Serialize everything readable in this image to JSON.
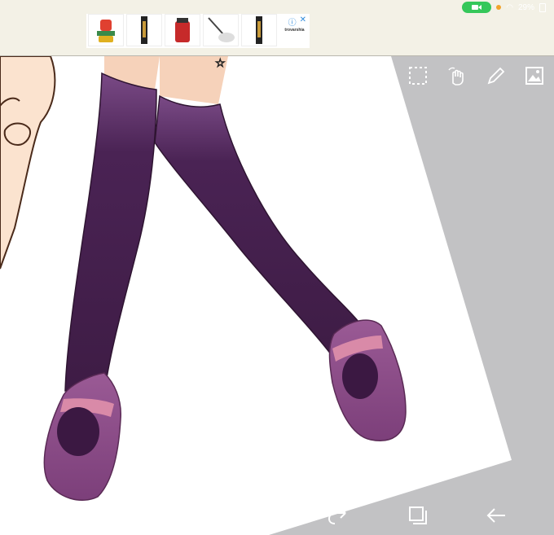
{
  "status_bar": {
    "battery_text": "29%"
  },
  "ad": {
    "brand_text": "trovarshia",
    "info_icon": "info-icon",
    "close_icon": "close-icon"
  },
  "toolbar": {
    "icons": [
      "select-icon",
      "hand-icon",
      "pencil-icon",
      "image-icon"
    ]
  },
  "bottom_nav": {
    "icons": [
      "circle-icon",
      "square-icon",
      "up-arrow-icon",
      "undo-icon",
      "redo-icon",
      "layers-icon",
      "back-arrow-icon"
    ]
  },
  "colors": {
    "sock": "#4a2150",
    "shoe": "#8a4a86",
    "skin": "#fbe3cf",
    "canvas_gray": "#c2c2c4"
  }
}
